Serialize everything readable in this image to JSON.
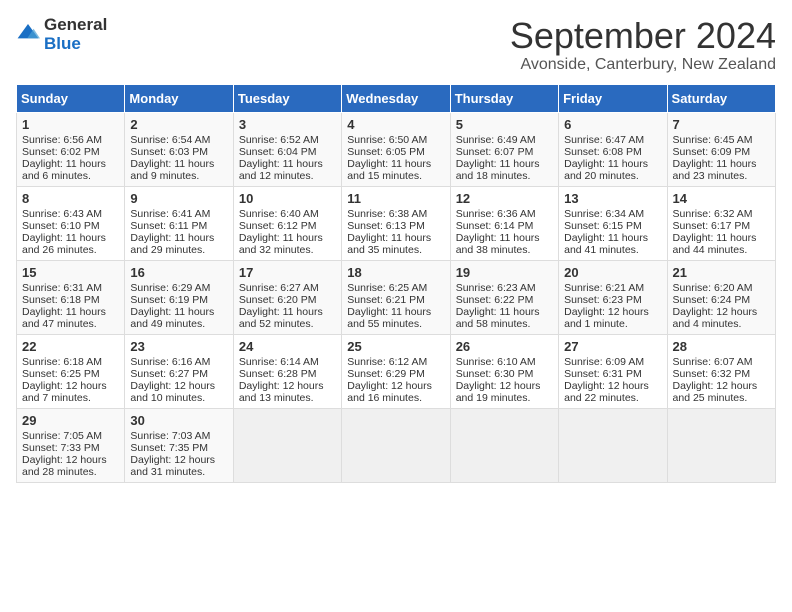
{
  "header": {
    "logo_general": "General",
    "logo_blue": "Blue",
    "month_year": "September 2024",
    "location": "Avonside, Canterbury, New Zealand"
  },
  "weekdays": [
    "Sunday",
    "Monday",
    "Tuesday",
    "Wednesday",
    "Thursday",
    "Friday",
    "Saturday"
  ],
  "weeks": [
    [
      {
        "day": 1,
        "lines": [
          "Sunrise: 6:56 AM",
          "Sunset: 6:02 PM",
          "Daylight: 11 hours",
          "and 6 minutes."
        ]
      },
      {
        "day": 2,
        "lines": [
          "Sunrise: 6:54 AM",
          "Sunset: 6:03 PM",
          "Daylight: 11 hours",
          "and 9 minutes."
        ]
      },
      {
        "day": 3,
        "lines": [
          "Sunrise: 6:52 AM",
          "Sunset: 6:04 PM",
          "Daylight: 11 hours",
          "and 12 minutes."
        ]
      },
      {
        "day": 4,
        "lines": [
          "Sunrise: 6:50 AM",
          "Sunset: 6:05 PM",
          "Daylight: 11 hours",
          "and 15 minutes."
        ]
      },
      {
        "day": 5,
        "lines": [
          "Sunrise: 6:49 AM",
          "Sunset: 6:07 PM",
          "Daylight: 11 hours",
          "and 18 minutes."
        ]
      },
      {
        "day": 6,
        "lines": [
          "Sunrise: 6:47 AM",
          "Sunset: 6:08 PM",
          "Daylight: 11 hours",
          "and 20 minutes."
        ]
      },
      {
        "day": 7,
        "lines": [
          "Sunrise: 6:45 AM",
          "Sunset: 6:09 PM",
          "Daylight: 11 hours",
          "and 23 minutes."
        ]
      }
    ],
    [
      {
        "day": 8,
        "lines": [
          "Sunrise: 6:43 AM",
          "Sunset: 6:10 PM",
          "Daylight: 11 hours",
          "and 26 minutes."
        ]
      },
      {
        "day": 9,
        "lines": [
          "Sunrise: 6:41 AM",
          "Sunset: 6:11 PM",
          "Daylight: 11 hours",
          "and 29 minutes."
        ]
      },
      {
        "day": 10,
        "lines": [
          "Sunrise: 6:40 AM",
          "Sunset: 6:12 PM",
          "Daylight: 11 hours",
          "and 32 minutes."
        ]
      },
      {
        "day": 11,
        "lines": [
          "Sunrise: 6:38 AM",
          "Sunset: 6:13 PM",
          "Daylight: 11 hours",
          "and 35 minutes."
        ]
      },
      {
        "day": 12,
        "lines": [
          "Sunrise: 6:36 AM",
          "Sunset: 6:14 PM",
          "Daylight: 11 hours",
          "and 38 minutes."
        ]
      },
      {
        "day": 13,
        "lines": [
          "Sunrise: 6:34 AM",
          "Sunset: 6:15 PM",
          "Daylight: 11 hours",
          "and 41 minutes."
        ]
      },
      {
        "day": 14,
        "lines": [
          "Sunrise: 6:32 AM",
          "Sunset: 6:17 PM",
          "Daylight: 11 hours",
          "and 44 minutes."
        ]
      }
    ],
    [
      {
        "day": 15,
        "lines": [
          "Sunrise: 6:31 AM",
          "Sunset: 6:18 PM",
          "Daylight: 11 hours",
          "and 47 minutes."
        ]
      },
      {
        "day": 16,
        "lines": [
          "Sunrise: 6:29 AM",
          "Sunset: 6:19 PM",
          "Daylight: 11 hours",
          "and 49 minutes."
        ]
      },
      {
        "day": 17,
        "lines": [
          "Sunrise: 6:27 AM",
          "Sunset: 6:20 PM",
          "Daylight: 11 hours",
          "and 52 minutes."
        ]
      },
      {
        "day": 18,
        "lines": [
          "Sunrise: 6:25 AM",
          "Sunset: 6:21 PM",
          "Daylight: 11 hours",
          "and 55 minutes."
        ]
      },
      {
        "day": 19,
        "lines": [
          "Sunrise: 6:23 AM",
          "Sunset: 6:22 PM",
          "Daylight: 11 hours",
          "and 58 minutes."
        ]
      },
      {
        "day": 20,
        "lines": [
          "Sunrise: 6:21 AM",
          "Sunset: 6:23 PM",
          "Daylight: 12 hours",
          "and 1 minute."
        ]
      },
      {
        "day": 21,
        "lines": [
          "Sunrise: 6:20 AM",
          "Sunset: 6:24 PM",
          "Daylight: 12 hours",
          "and 4 minutes."
        ]
      }
    ],
    [
      {
        "day": 22,
        "lines": [
          "Sunrise: 6:18 AM",
          "Sunset: 6:25 PM",
          "Daylight: 12 hours",
          "and 7 minutes."
        ]
      },
      {
        "day": 23,
        "lines": [
          "Sunrise: 6:16 AM",
          "Sunset: 6:27 PM",
          "Daylight: 12 hours",
          "and 10 minutes."
        ]
      },
      {
        "day": 24,
        "lines": [
          "Sunrise: 6:14 AM",
          "Sunset: 6:28 PM",
          "Daylight: 12 hours",
          "and 13 minutes."
        ]
      },
      {
        "day": 25,
        "lines": [
          "Sunrise: 6:12 AM",
          "Sunset: 6:29 PM",
          "Daylight: 12 hours",
          "and 16 minutes."
        ]
      },
      {
        "day": 26,
        "lines": [
          "Sunrise: 6:10 AM",
          "Sunset: 6:30 PM",
          "Daylight: 12 hours",
          "and 19 minutes."
        ]
      },
      {
        "day": 27,
        "lines": [
          "Sunrise: 6:09 AM",
          "Sunset: 6:31 PM",
          "Daylight: 12 hours",
          "and 22 minutes."
        ]
      },
      {
        "day": 28,
        "lines": [
          "Sunrise: 6:07 AM",
          "Sunset: 6:32 PM",
          "Daylight: 12 hours",
          "and 25 minutes."
        ]
      }
    ],
    [
      {
        "day": 29,
        "lines": [
          "Sunrise: 7:05 AM",
          "Sunset: 7:33 PM",
          "Daylight: 12 hours",
          "and 28 minutes."
        ]
      },
      {
        "day": 30,
        "lines": [
          "Sunrise: 7:03 AM",
          "Sunset: 7:35 PM",
          "Daylight: 12 hours",
          "and 31 minutes."
        ]
      },
      null,
      null,
      null,
      null,
      null
    ]
  ]
}
